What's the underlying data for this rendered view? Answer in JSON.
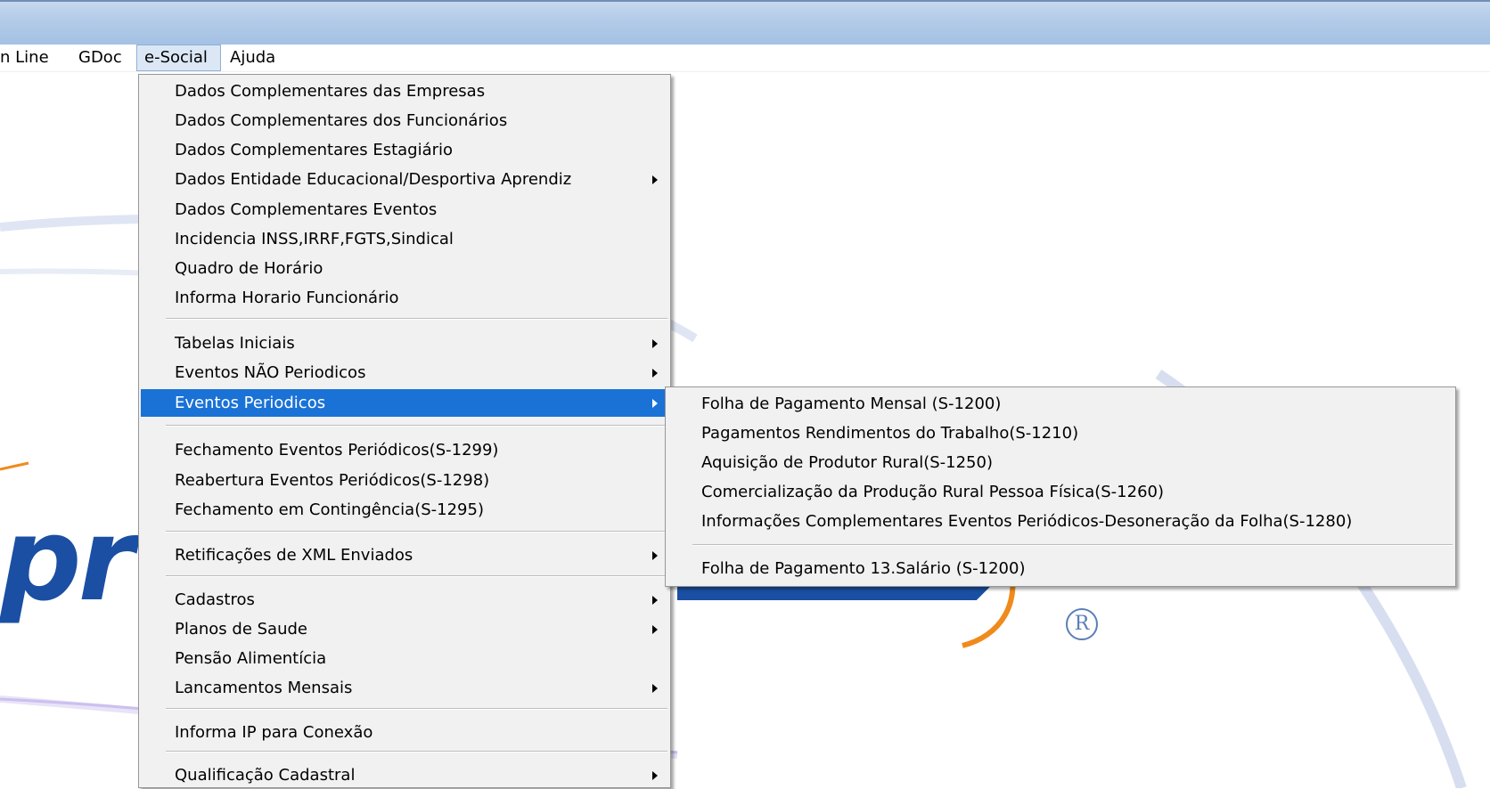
{
  "menubar": {
    "items": [
      {
        "label": "n Line",
        "open": false
      },
      {
        "label": "GDoc",
        "open": false
      },
      {
        "label": "e-Social",
        "open": true
      },
      {
        "label": "Ajuda",
        "open": false
      }
    ]
  },
  "background": {
    "logo_text": "pr",
    "registered_mark": "R"
  },
  "esocial_menu": {
    "items": [
      {
        "label": "Dados Complementares das Empresas",
        "submenu": false
      },
      {
        "label": "Dados Complementares dos Funcionários",
        "submenu": false
      },
      {
        "label": "Dados Complementares Estagiário",
        "submenu": false
      },
      {
        "label": "Dados Entidade Educacional/Desportiva Aprendiz",
        "submenu": true
      },
      {
        "label": "Dados Complementares Eventos",
        "submenu": false
      },
      {
        "label": "Incidencia INSS,IRRF,FGTS,Sindical",
        "submenu": false
      },
      {
        "label": "Quadro de Horário",
        "submenu": false
      },
      {
        "label": "Informa Horario Funcionário",
        "submenu": false
      },
      {
        "label": "Tabelas Iniciais",
        "submenu": true
      },
      {
        "label": "Eventos NÃO Periodicos",
        "submenu": true
      },
      {
        "label": "Eventos Periodicos",
        "submenu": true,
        "highlighted": true
      },
      {
        "label": "Fechamento Eventos Periódicos(S-1299)",
        "submenu": false
      },
      {
        "label": "Reabertura Eventos Periódicos(S-1298)",
        "submenu": false
      },
      {
        "label": "Fechamento em Contingência(S-1295)",
        "submenu": false
      },
      {
        "label": "Retificações de XML Enviados",
        "submenu": true
      },
      {
        "label": "Cadastros",
        "submenu": true
      },
      {
        "label": "Planos de Saude",
        "submenu": true
      },
      {
        "label": "Pensão Alimentícia",
        "submenu": false
      },
      {
        "label": "Lancamentos Mensais",
        "submenu": true
      },
      {
        "label": "Informa IP para Conexão",
        "submenu": false
      },
      {
        "label": "Qualificação Cadastral",
        "submenu": true
      }
    ]
  },
  "eventos_periodicos_submenu": {
    "items": [
      {
        "label": "Folha de Pagamento Mensal (S-1200)"
      },
      {
        "label": "Pagamentos Rendimentos do Trabalho(S-1210)"
      },
      {
        "label": "Aquisição de Produtor Rural(S-1250)"
      },
      {
        "label": "Comercialização da Produção Rural Pessoa Física(S-1260)"
      },
      {
        "label": "Informações Complementares Eventos Periódicos-Desoneração da Folha(S-1280)"
      },
      {
        "label": "Folha de Pagamento 13.Salário (S-1200)"
      }
    ]
  },
  "colors": {
    "highlight": "#1a72d6",
    "menu_background": "#f1f1f1",
    "titlebar": "#b2cbe8",
    "logo_blue": "#1a4fa3",
    "logo_orange": "#f08a1c"
  }
}
